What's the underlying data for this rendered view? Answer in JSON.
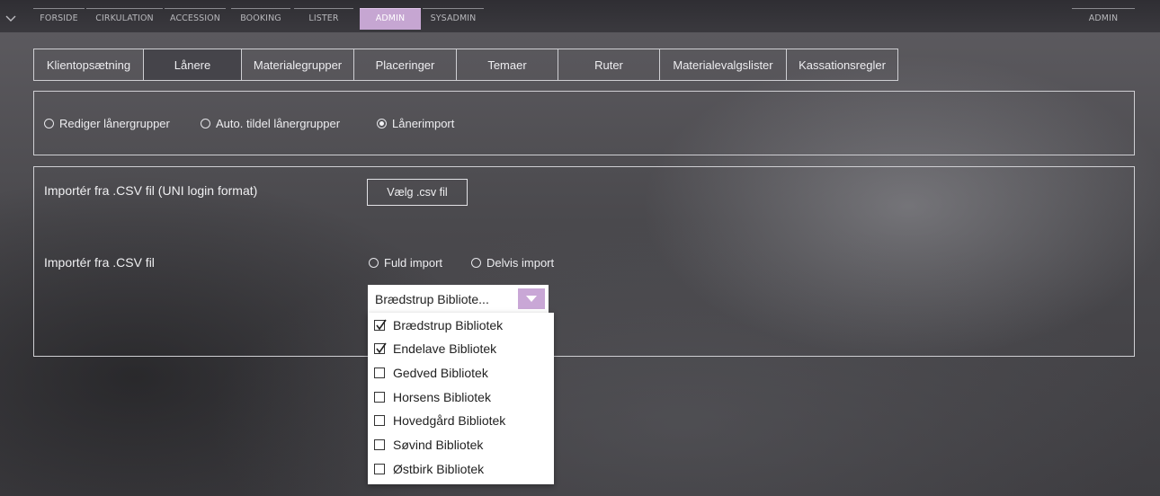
{
  "topnav": {
    "items": [
      {
        "label": "FORSIDE"
      },
      {
        "label": "CIRKULATION"
      },
      {
        "label": "ACCESSION"
      },
      {
        "label": "BOOKING"
      },
      {
        "label": "LISTER"
      },
      {
        "label": "ADMIN"
      },
      {
        "label": "SYSADMIN"
      }
    ],
    "active": "ADMIN",
    "user_label": "ADMIN"
  },
  "tabs": {
    "items": [
      {
        "label": "Klientopsætning"
      },
      {
        "label": "Lånere"
      },
      {
        "label": "Materialegrupper"
      },
      {
        "label": "Placeringer"
      },
      {
        "label": "Temaer"
      },
      {
        "label": "Ruter"
      },
      {
        "label": "Materialevalgslister"
      },
      {
        "label": "Kassationsregler"
      }
    ],
    "active": "Lånere"
  },
  "mode": {
    "options": [
      {
        "label": "Rediger lånergrupper",
        "selected": false
      },
      {
        "label": "Auto. tildel lånergrupper",
        "selected": false
      },
      {
        "label": "Lånerimport",
        "selected": true
      }
    ]
  },
  "import": {
    "uni_label": "Importér fra .CSV fil (UNI login format)",
    "choose_csv_label": "Vælg .csv fil",
    "csv_label": "Importér fra .CSV fil",
    "import_type": [
      {
        "label": "Fuld import",
        "selected": false
      },
      {
        "label": "Delvis import",
        "selected": false
      }
    ],
    "library_select": {
      "value": "Brædstrup Bibliote...",
      "options": [
        {
          "label": "Brædstrup Bibliotek",
          "checked": true
        },
        {
          "label": "Endelave Bibliotek",
          "checked": true
        },
        {
          "label": "Gedved Bibliotek",
          "checked": false
        },
        {
          "label": "Horsens Bibliotek",
          "checked": false
        },
        {
          "label": "Hovedgård Bibliotek",
          "checked": false
        },
        {
          "label": "Søvind Bibliotek",
          "checked": false
        },
        {
          "label": "Østbirk Bibliotek",
          "checked": false
        }
      ]
    }
  },
  "colors": {
    "accent": "#c9a7d6",
    "nav_active": "#c6a6d2",
    "background": "#4a494d"
  },
  "icons": {
    "menu": "chevron-down-icon",
    "select_arrow": "triangle-down-icon",
    "checked": "check-icon"
  }
}
